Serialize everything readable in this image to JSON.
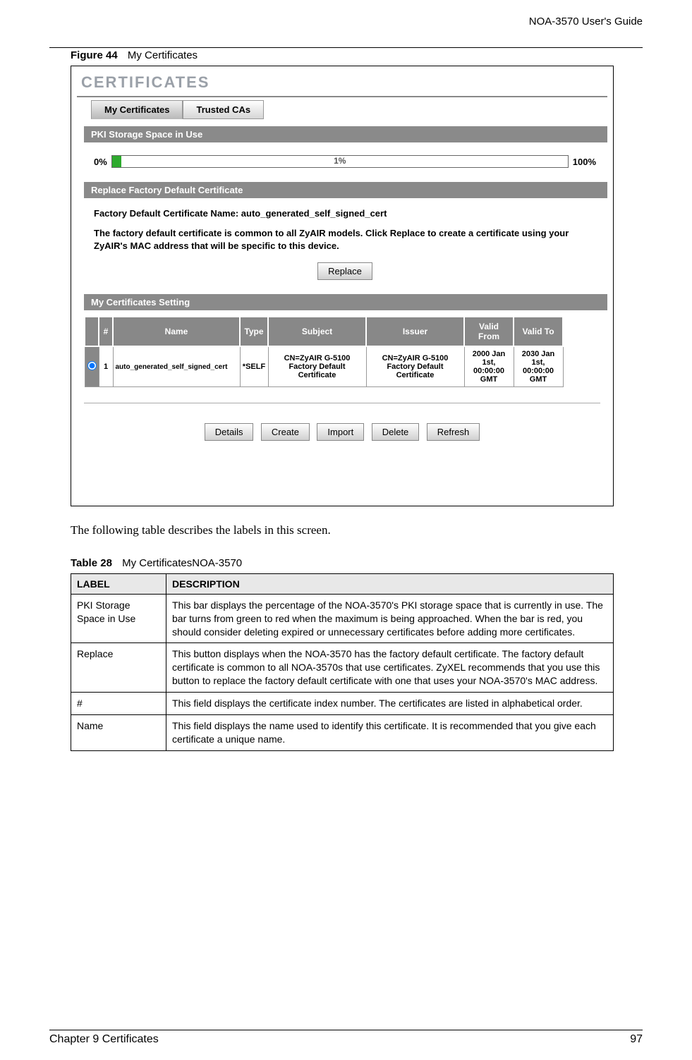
{
  "header": {
    "guide": "NOA-3570 User's Guide"
  },
  "figure": {
    "label": "Figure 44",
    "title": "My Certificates"
  },
  "screenshot": {
    "title": "CERTIFICATES",
    "tabs": [
      "My Certificates",
      "Trusted CAs"
    ],
    "active_tab": 0,
    "sections": {
      "storage": {
        "header": "PKI Storage Space in Use",
        "min": "0%",
        "mid": "1%",
        "max": "100%",
        "fill_percent": 2
      },
      "replace": {
        "header": "Replace Factory Default Certificate",
        "cert_name_label": "Factory Default Certificate Name: auto_generated_self_signed_cert",
        "desc": "The factory default certificate is common to all ZyAIR models. Click Replace to create a certificate using your ZyAIR's MAC address that will be specific to this device.",
        "button": "Replace"
      },
      "settings": {
        "header": "My Certificates Setting",
        "columns": [
          "#",
          "Name",
          "Type",
          "Subject",
          "Issuer",
          "Valid From",
          "Valid To"
        ],
        "rows": [
          {
            "num": "1",
            "name": "auto_generated_self_signed_cert",
            "type": "*SELF",
            "subject": "CN=ZyAIR G-5100 Factory Default Certificate",
            "issuer": "CN=ZyAIR G-5100 Factory Default Certificate",
            "valid_from": "2000 Jan 1st, 00:00:00 GMT",
            "valid_to": "2030 Jan 1st, 00:00:00 GMT"
          }
        ]
      },
      "buttons": [
        "Details",
        "Create",
        "Import",
        "Delete",
        "Refresh"
      ]
    }
  },
  "body_text": "The following table describes the labels in this screen.",
  "table": {
    "label": "Table 28",
    "title": "My CertificatesNOA-3570",
    "headers": [
      "LABEL",
      "DESCRIPTION"
    ],
    "rows": [
      {
        "label": "PKI Storage Space in Use",
        "desc": "This bar displays the percentage of the NOA-3570's PKI storage space that is currently in use. The bar turns from green to red when the maximum is being approached. When the bar is red, you should consider deleting expired or unnecessary certificates before adding more certificates."
      },
      {
        "label": "Replace",
        "desc": "This button displays when the NOA-3570 has the factory default certificate. The factory default certificate is common to all NOA-3570s that use certificates. ZyXEL recommends that you use this button to replace the factory default certificate with one that uses your NOA-3570's MAC address."
      },
      {
        "label": "#",
        "desc": "This field displays the certificate index number. The certificates are listed in alphabetical order."
      },
      {
        "label": "Name",
        "desc": "This field displays the name used to identify this certificate. It is recommended that you give each certificate a unique name."
      }
    ]
  },
  "footer": {
    "chapter": "Chapter 9 Certificates",
    "page": "97"
  }
}
